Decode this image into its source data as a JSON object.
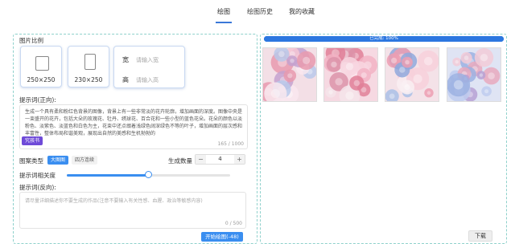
{
  "nav": {
    "tabs": [
      {
        "label": "绘图",
        "active": true
      },
      {
        "label": "绘图历史",
        "active": false
      },
      {
        "label": "我的收藏",
        "active": false
      }
    ],
    "accent_color": "#3a78d8"
  },
  "left_panel": {
    "ratio_title": "图片比例",
    "ratio_options": [
      {
        "label": "250×250",
        "icon": "square-ratio-icon"
      },
      {
        "label": "230×250",
        "icon": "portrait-ratio-icon"
      }
    ],
    "custom_size": {
      "width_label": "宽",
      "width_placeholder": "请输入宽",
      "height_label": "高",
      "height_placeholder": "请输入高"
    },
    "prompt_title": "提示词(正向):",
    "prompt_text": "生成一个具有柔和粉红色背景的图像，背景上有一些非常淡的花卉轮廓，增加画面的深度。图像中央是一束盛开的花卉，包括大朵的玫瑰花、牡丹、绣球花、百合花和一些小型的蓝色花朵。花朵的颜色以淡粉色、淡紫色、淡蓝色和白色为主，花束中还点缀着浅绿色阔深绿色不等的叶子，增加画面的层次感和丰富性，整体布局和谐美观，展现出自然的美感和生机勃勃的",
    "prompt_counter": "165 / 1000",
    "badge_label": "究孩书",
    "type_title": "图案类型",
    "type_options": [
      {
        "label": "大图图",
        "active": true
      },
      {
        "label": "四方连续",
        "active": false
      }
    ],
    "quantity_title": "生成数量",
    "quantity_value": "4",
    "minus_label": "−",
    "plus_label": "+",
    "relevance_title": "提示词相关度",
    "relevance_level": 0.5,
    "negative_title": "提示词(反向):",
    "negative_placeholder": "请尽量详细描述你不要生成的作品(注意不要输入有关性感、血腥、政治等敏感内容)",
    "negative_counter": "0 / 500",
    "start_button": "开始绘图(-48)"
  },
  "right_panel": {
    "progress_text": "已完成: 100%",
    "progress_level": 1.0,
    "download_button": "下载",
    "images": [
      {
        "name": "generated-image-1",
        "bg": "#f3dfe6",
        "palette": [
          "#e89aae",
          "#f5c6d3",
          "#b9c9ea",
          "#f9e8ee",
          "#c4a2cf"
        ]
      },
      {
        "name": "generated-image-2",
        "bg": "#f6d9e2",
        "palette": [
          "#e07f98",
          "#f2b3c4",
          "#f8d6e0",
          "#dc93a9",
          "#f5e4ea"
        ]
      },
      {
        "name": "generated-image-3",
        "bg": "#f4e2e8",
        "palette": [
          "#ec9db2",
          "#a9bfe6",
          "#f7d0db",
          "#8fa8dc",
          "#f9eef2"
        ]
      },
      {
        "name": "generated-image-4",
        "bg": "#dfe4f4",
        "palette": [
          "#9cb2e2",
          "#e9a9bd",
          "#c0cdee",
          "#f3cbd7",
          "#b7a1d4"
        ]
      }
    ]
  }
}
